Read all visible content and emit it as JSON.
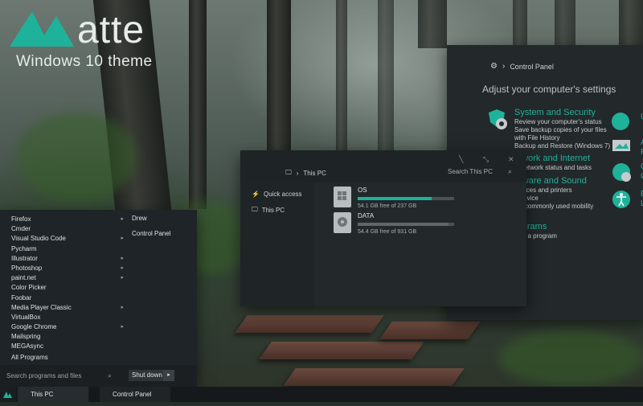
{
  "logo": {
    "word": "atte",
    "subtitle": "Windows 10 theme"
  },
  "control_panel": {
    "title": "Control Panel",
    "heading": "Adjust your computer's settings",
    "items": [
      {
        "title": "System and Security",
        "lines": [
          "Review your computer's status",
          "Save backup copies of your files",
          "with File History",
          "Backup and Restore (Windows 7)"
        ]
      },
      {
        "title": "etwork and Internet",
        "lines": [
          "w network status and tasks"
        ]
      },
      {
        "title": "rdware and Sound",
        "lines": [
          "a device",
          "devices and printers",
          "ust commonly used mobility",
          "ings"
        ]
      },
      {
        "title": "rograms",
        "lines": [
          "stall a program"
        ]
      }
    ],
    "right_edge_labels": [
      "U",
      "A\nF",
      "C\nC",
      "E\nL"
    ]
  },
  "explorer": {
    "path": "This PC",
    "search_placeholder": "Search This PC",
    "nav": [
      "Quick access",
      "This PC"
    ],
    "drives": [
      {
        "name": "OS",
        "free_text": "54.1 GB free of 237 GB",
        "used_fraction": 0.77
      },
      {
        "name": "DATA",
        "free_text": "54.4 GB free of 931 GB",
        "used_fraction": 0.94
      }
    ]
  },
  "start_menu": {
    "apps": [
      {
        "label": "Firefox",
        "has_arrow": true
      },
      {
        "label": "Cmder",
        "has_arrow": false
      },
      {
        "label": "Visual Studio Code",
        "has_arrow": true
      },
      {
        "label": "Pycharm",
        "has_arrow": false
      },
      {
        "label": "Illustrator",
        "has_arrow": true
      },
      {
        "label": "Photoshop",
        "has_arrow": true
      },
      {
        "label": "paint.net",
        "has_arrow": true
      },
      {
        "label": "Color Picker",
        "has_arrow": false
      },
      {
        "label": "Foobar",
        "has_arrow": false
      },
      {
        "label": "Media Player Classic",
        "has_arrow": true
      },
      {
        "label": "VirtualBox",
        "has_arrow": false
      },
      {
        "label": "Google Chrome",
        "has_arrow": true
      },
      {
        "label": "Mailspring",
        "has_arrow": false
      },
      {
        "label": "MEGAsync",
        "has_arrow": false
      }
    ],
    "all_programs": "All Programs",
    "side_links": [
      "Drew",
      "Control Panel"
    ],
    "search_placeholder": "Search programs and files",
    "shutdown_label": "Shut down",
    "shutdown_arrow": "▸"
  },
  "taskbar": {
    "items": [
      "This PC",
      "Control Panel"
    ]
  },
  "colors": {
    "accent": "#1fb29a",
    "window_bg": "#23282b",
    "taskbar_bg": "#16191b"
  }
}
